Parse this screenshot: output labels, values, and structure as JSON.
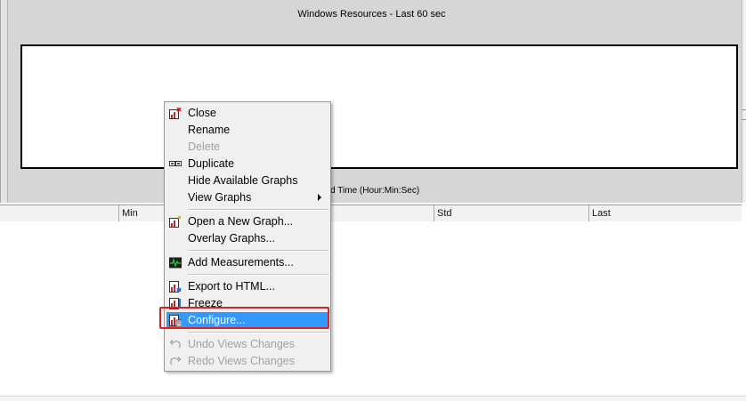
{
  "graph": {
    "title": "Windows Resources - Last 60 sec",
    "x_axis_label": "osed Time (Hour:Min:Sec)"
  },
  "table": {
    "columns": [
      "",
      "Min",
      "",
      "Std",
      "Last"
    ]
  },
  "context_menu": {
    "items": [
      {
        "label": "Close",
        "icon": "close-graph-icon",
        "enabled": true
      },
      {
        "label": "Rename",
        "enabled": true
      },
      {
        "label": "Delete",
        "enabled": false
      },
      {
        "label": "Duplicate",
        "icon": "duplicate-icon",
        "enabled": true
      },
      {
        "label": "Hide Available Graphs",
        "enabled": true
      },
      {
        "label": "View Graphs",
        "enabled": true,
        "submenu": true
      },
      {
        "label": "Open a New Graph...",
        "icon": "new-graph-icon",
        "enabled": true
      },
      {
        "label": "Overlay Graphs...",
        "enabled": true
      },
      {
        "label": "Add Measurements...",
        "icon": "measurements-icon",
        "enabled": true
      },
      {
        "label": "Export to HTML...",
        "icon": "export-html-icon",
        "enabled": true
      },
      {
        "label": "Freeze",
        "icon": "freeze-icon",
        "enabled": true
      },
      {
        "label": "Configure...",
        "icon": "configure-icon",
        "enabled": true,
        "selected": true
      },
      {
        "label": "Undo Views Changes",
        "icon": "undo-icon",
        "enabled": false
      },
      {
        "label": "Redo Views Changes",
        "icon": "redo-icon",
        "enabled": false
      }
    ]
  },
  "colors": {
    "selection": "#3399ff",
    "highlight_box": "#e02020",
    "panel_bg": "#d6d6d6"
  }
}
